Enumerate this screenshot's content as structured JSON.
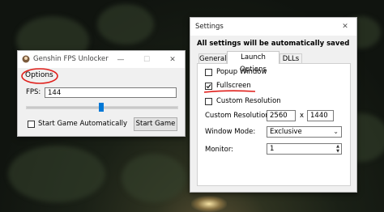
{
  "unlocker": {
    "title": "Genshin FPS Unlocker",
    "section_label": "Options",
    "fps_label": "FPS:",
    "fps_value": "144",
    "slider_level": 0.5,
    "start_auto_label": "Start Game Automatically",
    "start_auto_checked": false,
    "start_button": "Start Game",
    "controls": {
      "minimize": "—",
      "maximize": "☐",
      "close": "✕"
    }
  },
  "settings": {
    "title": "Settings",
    "close": "✕",
    "header": "All settings will be automatically saved",
    "tabs": [
      {
        "label": "General",
        "active": false
      },
      {
        "label": "Launch Options",
        "active": true
      },
      {
        "label": "DLLs",
        "active": false
      }
    ],
    "options": {
      "popup_window": {
        "label": "Popup Window",
        "checked": false
      },
      "fullscreen": {
        "label": "Fullscreen",
        "checked": true
      },
      "custom_resolution": {
        "label": "Custom Resolution",
        "checked": false
      }
    },
    "custom_resolution_label": "Custom Resolution:",
    "resolution_width": "2560",
    "resolution_sep": "x",
    "resolution_height": "1440",
    "window_mode_label": "Window Mode:",
    "window_mode_value": "Exclusive",
    "monitor_label": "Monitor:",
    "monitor_value": "1",
    "annotation_color": "#e0201c"
  }
}
